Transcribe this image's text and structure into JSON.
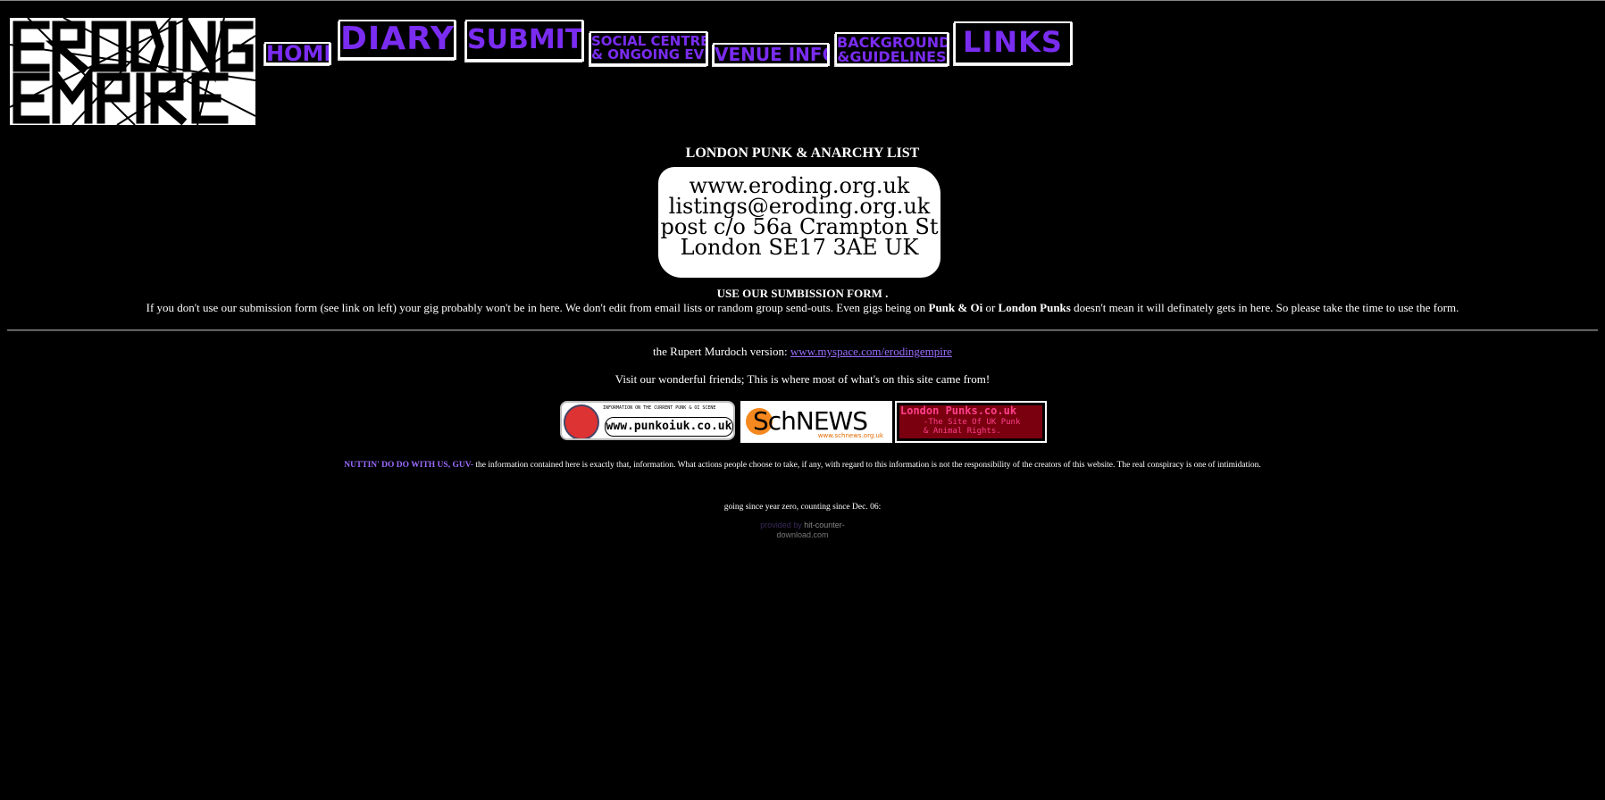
{
  "header": {
    "nav": [
      {
        "label": "HOME",
        "id": "home"
      },
      {
        "label": "DIARY",
        "id": "diary"
      },
      {
        "label": "SUBMIT",
        "id": "submit"
      },
      {
        "label": "SOCIAL CENTRES & ONGOING EVENTS",
        "line1": "SOCIAL CENTRES",
        "line2": "& ONGOING EVENTS",
        "id": "social"
      },
      {
        "label": "VENUE INFO",
        "id": "venue"
      },
      {
        "label": "BACKGROUND &GUIDELINES",
        "line1": "BACKGROUND",
        "line2": "&GUIDELINES",
        "id": "background"
      },
      {
        "label": "LINKS",
        "id": "links"
      }
    ],
    "logo_text": "ERODING EMPIRE"
  },
  "main": {
    "title": "LONDON PUNK & ANARCHY LIST",
    "stamp_lines": [
      "www.eroding.org.uk",
      "listings@eroding.org.uk",
      "post c/o 56a Crampton St",
      "London SE17 3AE UK"
    ],
    "use_form": "USE OUR SUMBISSION FORM .",
    "notice": {
      "part1": "If you don't use our submission form (see link on left) your gig probably won't be in here. We don't edit from email lists or random group send-outs. Even gigs being on ",
      "bold1": "Punk & Oi",
      "part2": " or ",
      "bold2": "London Punks",
      "part3": " doesn't mean it will definately gets in here. So please take the time to use the form."
    },
    "murdoch_text": "the Rupert Murdoch version: ",
    "murdoch_link": "www.myspace.com/erodingempire",
    "friends_text": "Visit our wonderful friends; This is where most of what's on this site came from!",
    "banners": {
      "punkoi_top": "INFORMATION ON THE CURRENT PUNK & OI SCENE",
      "punkoi_url": "www.punkoiuk.co.uk",
      "schnews_name": "SchNEWS",
      "schnews_url": "www.schnews.org.uk",
      "londonpunks_title": "London Punks.co.uk",
      "londonpunks_sub1": "-The Site Of UK Punk",
      "londonpunks_sub2": "& Animal Rights."
    },
    "disclaimer_lead": "NUTTIN' DO DO WITH US, GUV-",
    "disclaimer_text": " the information contained here is exactly that, information. What actions people choose to take, if any, with regard to this information is not the responsibility of the creators of this website. The real conspiracy is one of intimidation.",
    "since": "going since year zero, counting since Dec. 06:",
    "counter_pb": "provided by ",
    "counter_link1": "hit-counter-",
    "counter_link2": "download.com"
  },
  "colors": {
    "background": "#000000",
    "nav_purple": "#7a2cf0",
    "link": "#9b6dff"
  }
}
